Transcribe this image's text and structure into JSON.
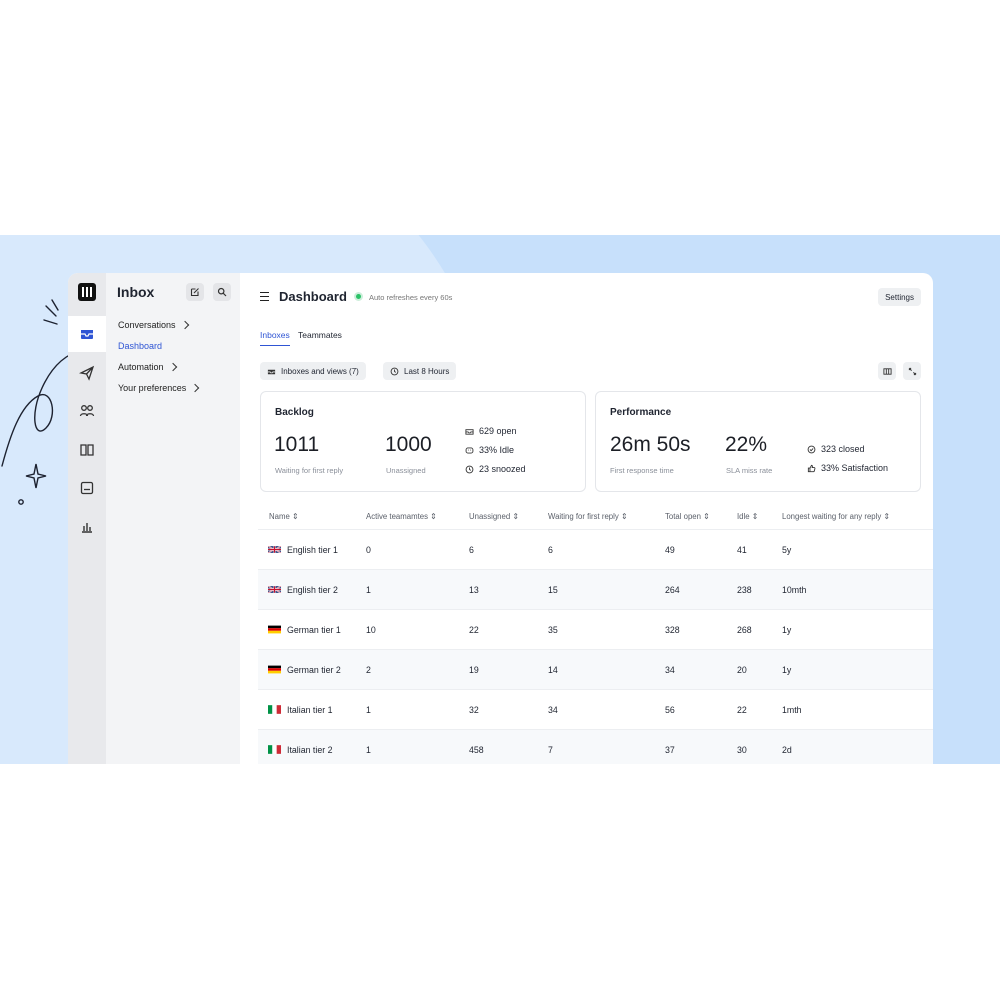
{
  "colors": {
    "accent": "#2f55d4",
    "banner": "#c7e0fb",
    "live": "#2bc267"
  },
  "sidebar": {
    "title": "Inbox",
    "compose_icon": "compose-icon",
    "search_icon": "search-icon",
    "items": [
      {
        "label": "Conversations",
        "chevron": true
      },
      {
        "label": "Dashboard",
        "active": true
      },
      {
        "label": "Automation",
        "chevron": true
      },
      {
        "label": "Your preferences",
        "chevron": true
      }
    ]
  },
  "rail": {
    "icons": [
      "intercom-logo",
      "inbox-icon",
      "paper-plane-icon",
      "people-icon",
      "book-icon",
      "message-box-icon",
      "bar-chart-icon"
    ]
  },
  "header": {
    "title": "Dashboard",
    "auto_refresh": "Auto refreshes every 60s",
    "settings_label": "Settings"
  },
  "tabs": [
    {
      "label": "Inboxes",
      "active": true
    },
    {
      "label": "Teammates"
    }
  ],
  "filters": {
    "inboxes": "Inboxes and views (7)",
    "time": "Last 8 Hours"
  },
  "backlog": {
    "title": "Backlog",
    "waiting_value": "1011",
    "waiting_label": "Waiting for first reply",
    "unassigned_value": "1000",
    "unassigned_label": "Unassigned",
    "open": "629 open",
    "idle": "33% Idle",
    "snoozed": "23 snoozed"
  },
  "performance": {
    "title": "Performance",
    "frt_value": "26m 50s",
    "frt_label": "First response time",
    "sla_value": "22%",
    "sla_label": "SLA miss rate",
    "closed": "323 closed",
    "satisfaction": "33% Satisfaction"
  },
  "table": {
    "columns": [
      "Name",
      "Active teamamtes",
      "Unassigned",
      "Waiting for first reply",
      "Total open",
      "Idle",
      "Longest waiting for any reply"
    ],
    "rows": [
      {
        "flag": "uk",
        "name": "English tier 1",
        "active": "0",
        "unassigned": "6",
        "waiting": "6",
        "total": "49",
        "idle": "41",
        "longest": "5y"
      },
      {
        "flag": "uk",
        "name": "English tier 2",
        "active": "1",
        "unassigned": "13",
        "waiting": "15",
        "total": "264",
        "idle": "238",
        "longest": "10mth"
      },
      {
        "flag": "de",
        "name": "German tier 1",
        "active": "10",
        "unassigned": "22",
        "waiting": "35",
        "total": "328",
        "idle": "268",
        "longest": "1y"
      },
      {
        "flag": "de",
        "name": "German tier 2",
        "active": "2",
        "unassigned": "19",
        "waiting": "14",
        "total": "34",
        "idle": "20",
        "longest": "1y"
      },
      {
        "flag": "it",
        "name": "Italian tier 1",
        "active": "1",
        "unassigned": "32",
        "waiting": "34",
        "total": "56",
        "idle": "22",
        "longest": "1mth"
      },
      {
        "flag": "it",
        "name": "Italian tier 2",
        "active": "1",
        "unassigned": "458",
        "waiting": "7",
        "total": "37",
        "idle": "30",
        "longest": "2d"
      }
    ]
  }
}
